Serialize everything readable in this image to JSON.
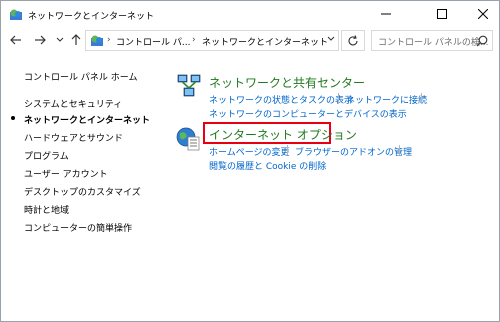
{
  "window": {
    "title": "ネットワークとインターネット"
  },
  "address": {
    "crumbs": [
      "コントロール パ...",
      "ネットワークとインターネット"
    ],
    "separator": "›"
  },
  "search": {
    "placeholder": "コントロール パネルの検..."
  },
  "leftnav": {
    "items": [
      {
        "label": "コントロール パネル ホーム",
        "current": false
      },
      {
        "label": "システムとセキュリティ",
        "current": false
      },
      {
        "label": "ネットワークとインターネット",
        "current": true
      },
      {
        "label": "ハードウェアとサウンド",
        "current": false
      },
      {
        "label": "プログラム",
        "current": false
      },
      {
        "label": "ユーザー アカウント",
        "current": false
      },
      {
        "label": "デスクトップのカスタマイズ",
        "current": false
      },
      {
        "label": "時計と地域",
        "current": false
      },
      {
        "label": "コンピューターの簡単操作",
        "current": false
      }
    ]
  },
  "categories": [
    {
      "title": "ネットワークと共有センター",
      "icon": "network-sharing-center-icon",
      "links": [
        "ネットワークの状態とタスクの表示",
        "ネットワークに接続",
        "ネットワークのコンピューターとデバイスの表示"
      ]
    },
    {
      "title": "インターネット オプション",
      "icon": "internet-options-icon",
      "links": [
        "ホームページの変更",
        "ブラウザーのアドオンの管理",
        "閲覧の履歴と Cookie の削除"
      ]
    }
  ],
  "colors": {
    "category_title": "#1e7a1e",
    "link": "#0066cc",
    "highlight": "#e60012"
  }
}
